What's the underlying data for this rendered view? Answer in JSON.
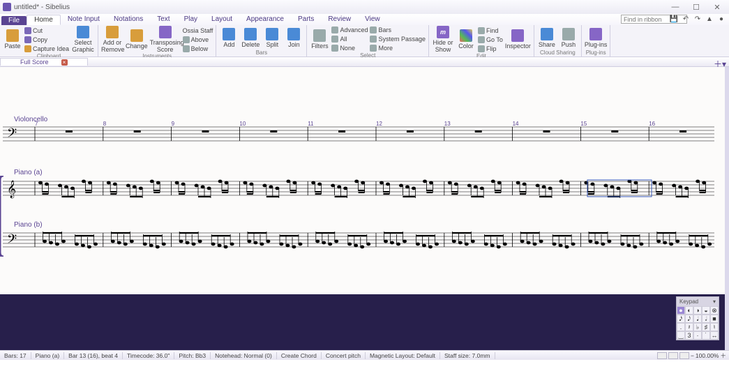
{
  "titlebar": {
    "doc": "untitled*",
    "app": "Sibelius"
  },
  "win": {
    "min": "—",
    "max": "☐",
    "close": "✕"
  },
  "qat": [
    "💾",
    "↶",
    "↷",
    "▲",
    "●"
  ],
  "menu": {
    "file": "File",
    "tabs": [
      "Home",
      "Note Input",
      "Notations",
      "Text",
      "Play",
      "Layout",
      "Appearance",
      "Parts",
      "Review",
      "View"
    ],
    "active": 0
  },
  "ribbon_search_placeholder": "Find in ribbon",
  "ribbon": {
    "clipboard": {
      "label": "Clipboard",
      "paste": "Paste",
      "cut": "Cut",
      "copy": "Copy",
      "capture": "Capture Idea",
      "select_graphic": "Select Graphic"
    },
    "instruments": {
      "label": "Instruments",
      "add_remove": "Add or Remove",
      "change": "Change",
      "transposing": "Transposing Score",
      "ossia": "Ossia Staff",
      "above": "Above",
      "below": "Below"
    },
    "bars": {
      "label": "Bars",
      "add": "Add",
      "delete": "Delete",
      "split": "Split",
      "join": "Join"
    },
    "select": {
      "label": "Select",
      "filters": "Filters",
      "advanced": "Advanced",
      "all": "All",
      "none": "None",
      "bars_btn": "Bars",
      "passage": "System Passage",
      "more": "More"
    },
    "edit": {
      "label": "Edit",
      "hide": "Hide or Show",
      "color": "Color",
      "find": "Find",
      "goto": "Go To",
      "flip": "Flip",
      "inspector": "Inspector"
    },
    "cloud": {
      "label": "Cloud Sharing",
      "share": "Share",
      "push": "Push"
    },
    "plugins": {
      "label": "Plug-ins",
      "plugins": "Plug-ins"
    }
  },
  "doctab": {
    "name": "Full Score"
  },
  "score": {
    "instruments": [
      "Violoncello",
      "Piano (a)",
      "Piano (b)"
    ],
    "bar_numbers": [
      7,
      8,
      9,
      10,
      11,
      12,
      13,
      14,
      15,
      16
    ]
  },
  "keypad": {
    "title": "Keypad",
    "rows": [
      [
        "●",
        "◐",
        "◑",
        "◒",
        "⊗"
      ],
      [
        "𝅘𝅥𝅯",
        "𝅘𝅥𝅮",
        "𝅘𝅥",
        "𝅗𝅥",
        "■"
      ],
      [
        ".",
        "𝄽",
        "♭",
        "♯",
        "♮"
      ],
      [
        "‿",
        "3",
        "·",
        "˙",
        "↔"
      ]
    ]
  },
  "status": {
    "cells": [
      "Bars: 17",
      "Piano (a)",
      "Bar 13 (16), beat 4",
      "Timecode: 36.0\"",
      "Pitch: Bb3",
      "Notehead: Normal (0)",
      "Create Chord",
      "Concert pitch",
      "Magnetic Layout: Default",
      "Staff size: 7.0mm"
    ],
    "zoom": "100.00%"
  }
}
